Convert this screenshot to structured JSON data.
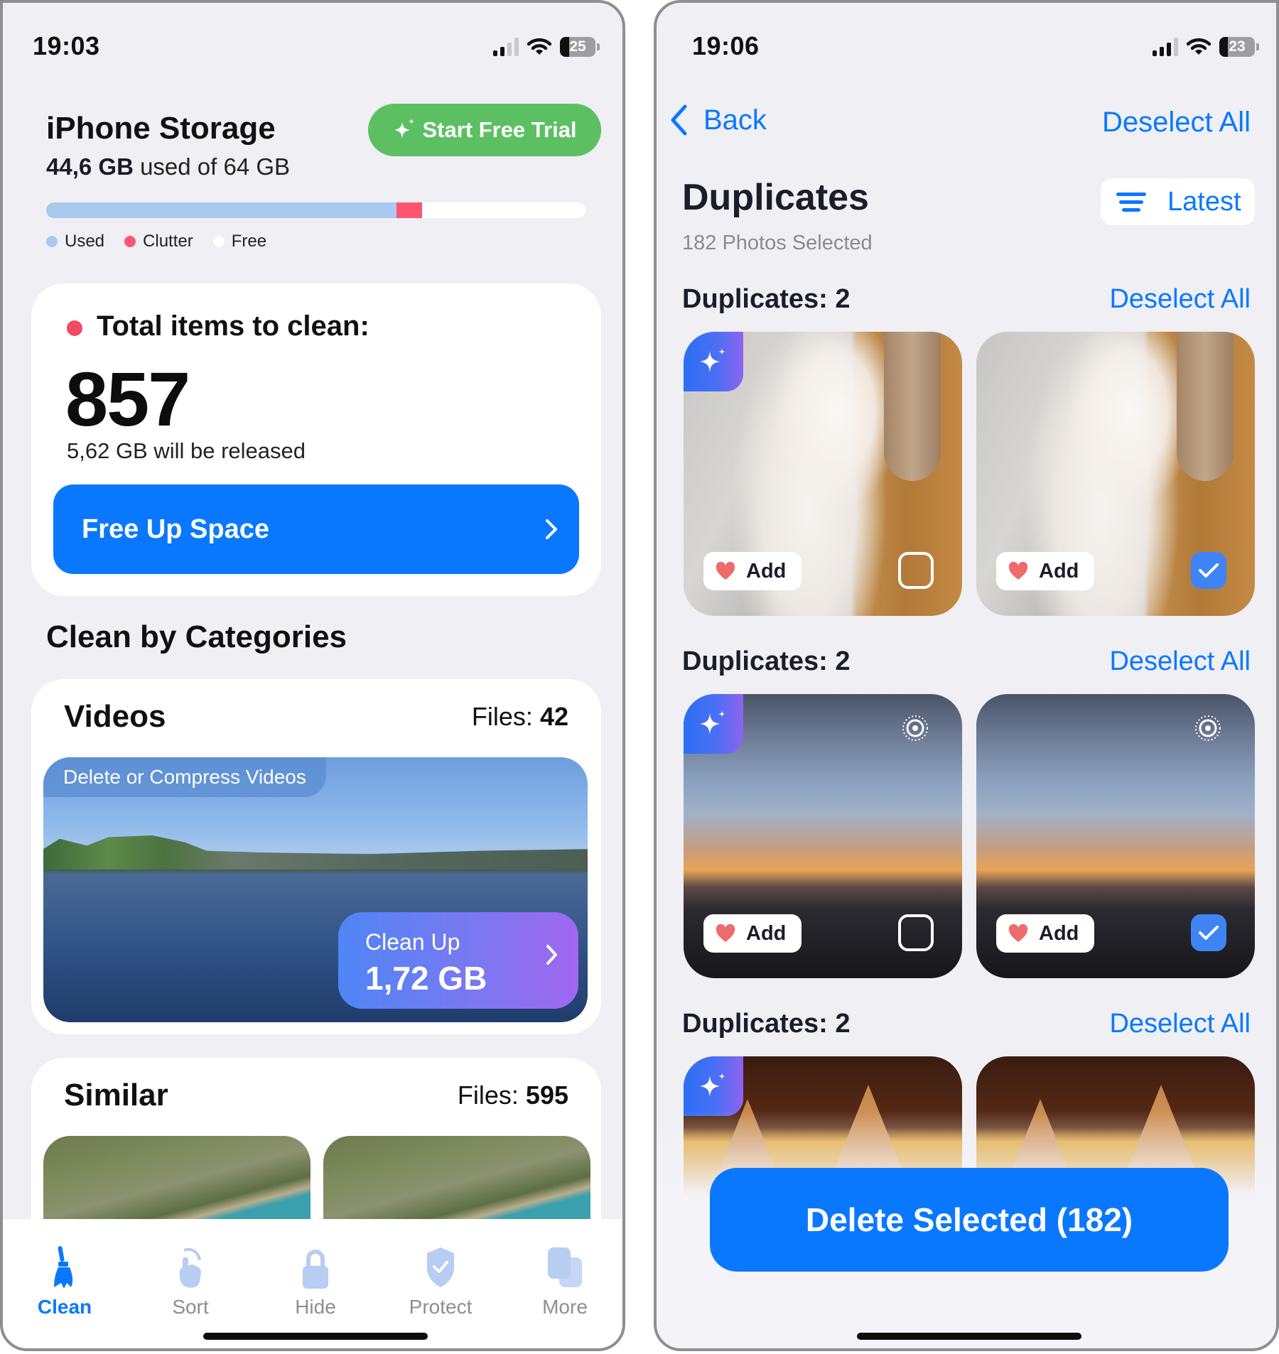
{
  "left_screen": {
    "status": {
      "time": "19:03",
      "battery": "25",
      "battery_pct": 25,
      "signal_bars": 2
    },
    "storage": {
      "title": "iPhone Storage",
      "used_value": "44,6 GB",
      "used_suffix": "used of 64 GB",
      "used_fraction": 0.65,
      "clutter_fraction": 0.047,
      "legend": [
        {
          "label": "Used",
          "color": "#a9c9ef"
        },
        {
          "label": "Clutter",
          "color": "#ff5670"
        },
        {
          "label": "Free",
          "color": "#ffffff"
        }
      ]
    },
    "trial_button": {
      "label": "Start Free Trial",
      "icon": "sparkles-icon"
    },
    "total_card": {
      "label": "Total items to clean:",
      "count": "857",
      "released": "5,62 GB will be released",
      "button_label": "Free Up Space"
    },
    "categories_title": "Clean by Categories",
    "videos": {
      "title": "Videos",
      "files_label": "Files:",
      "files_count": "42",
      "badge": "Delete or Compress Videos",
      "cleanup_label": "Clean Up",
      "cleanup_size": "1,72 GB"
    },
    "similar": {
      "title": "Similar",
      "files_label": "Files:",
      "files_count": "595"
    },
    "tabs": [
      {
        "label": "Clean",
        "icon": "broom-icon",
        "active": true
      },
      {
        "label": "Sort",
        "icon": "swipe-hand-icon",
        "active": false
      },
      {
        "label": "Hide",
        "icon": "lock-icon",
        "active": false
      },
      {
        "label": "Protect",
        "icon": "shield-check-icon",
        "active": false
      },
      {
        "label": "More",
        "icon": "stacked-squares-icon",
        "active": false
      }
    ]
  },
  "right_screen": {
    "status": {
      "time": "19:06",
      "battery": "23",
      "battery_pct": 23,
      "signal_bars": 3
    },
    "nav": {
      "back_label": "Back",
      "deselect_all_label": "Deselect All"
    },
    "title": "Duplicates",
    "subtitle": "182 Photos Selected",
    "sort_button": {
      "label": "Latest",
      "icon": "filter-lines-icon"
    },
    "groups": [
      {
        "title": "Duplicates: 2",
        "action": "Deselect All",
        "photos": [
          {
            "subject": "white kitten",
            "best": true,
            "selected": false,
            "add_label": "Add",
            "live": false
          },
          {
            "subject": "white kitten",
            "best": false,
            "selected": true,
            "add_label": "Add",
            "live": false
          }
        ]
      },
      {
        "title": "Duplicates: 2",
        "action": "Deselect All",
        "photos": [
          {
            "subject": "sunset street",
            "best": true,
            "selected": false,
            "add_label": "Add",
            "live": true
          },
          {
            "subject": "sunset street",
            "best": false,
            "selected": true,
            "add_label": "Add",
            "live": true
          }
        ]
      },
      {
        "title": "Duplicates: 2",
        "action": "Deselect All",
        "photos": [
          {
            "subject": "orange cat",
            "best": true
          },
          {
            "subject": "orange cat",
            "best": false
          }
        ]
      }
    ],
    "delete_button": {
      "label": "Delete Selected (182)"
    }
  },
  "colors": {
    "accent_blue": "#0a78fe",
    "trial_green": "#5cc063",
    "clutter_red": "#ff5670",
    "selected_check": "#3f84f4",
    "background": "#efeff4"
  }
}
